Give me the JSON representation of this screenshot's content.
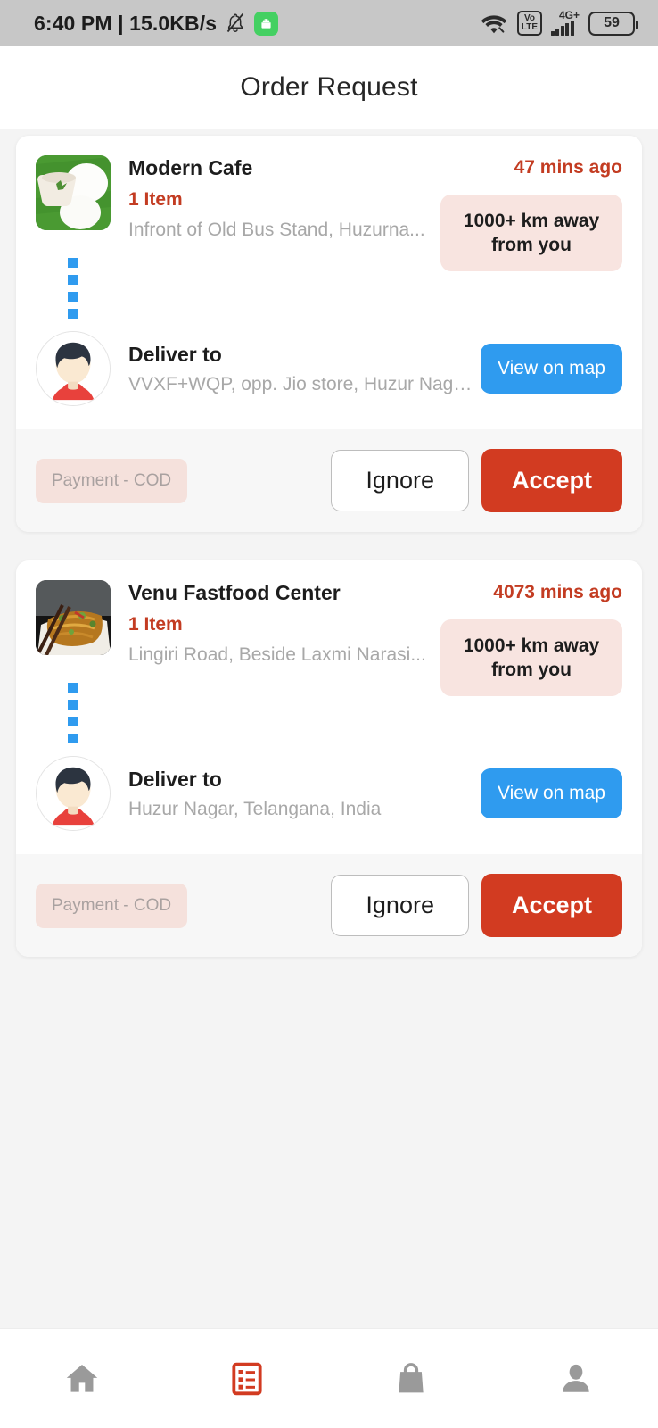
{
  "statusbar": {
    "clock": "6:40 PM | 15.0KB/s",
    "mute_icon": "bell-muted-icon",
    "app_icon": "android-app-icon",
    "wifi_icon": "wifi-icon",
    "volte_top": "Vo",
    "volte_bottom": "LTE",
    "network_label": "4G+",
    "battery_level": "59"
  },
  "appbar": {
    "title": "Order Request"
  },
  "orders": [
    {
      "vendor_name": "Modern Cafe",
      "time_ago": "47 mins ago",
      "item_count": "1 Item",
      "vendor_address": "Infront of Old Bus Stand, Huzurna...",
      "distance": "1000+ km away from you",
      "deliver_title": "Deliver to",
      "deliver_address": "VVXF+WQP, opp. Jio store, Huzur Nagar...",
      "map_button": "View on map",
      "payment": "Payment - COD",
      "ignore_button": "Ignore",
      "accept_button": "Accept",
      "thumb_icon": "idli-food-photo"
    },
    {
      "vendor_name": "Venu Fastfood Center",
      "time_ago": "4073 mins ago",
      "item_count": "1 Item",
      "vendor_address": "Lingiri Road, Beside Laxmi Narasi...",
      "distance": "1000+ km away from you",
      "deliver_title": "Deliver to",
      "deliver_address": "Huzur Nagar, Telangana, India",
      "map_button": "View on map",
      "payment": "Payment - COD",
      "ignore_button": "Ignore",
      "accept_button": "Accept",
      "thumb_icon": "noodles-food-photo"
    }
  ],
  "bottomnav": {
    "items": [
      {
        "name": "home-icon",
        "active": false
      },
      {
        "name": "orders-list-icon",
        "active": true
      },
      {
        "name": "shopping-bag-icon",
        "active": false
      },
      {
        "name": "profile-person-icon",
        "active": false
      }
    ],
    "active_color": "#d23b21",
    "inactive_color": "#9a9a9a"
  },
  "colors": {
    "accent_red": "#d23b21",
    "link_blue": "#2f9bef",
    "badge_pink": "#f8e4e0",
    "page_bg": "#f4f4f4"
  }
}
